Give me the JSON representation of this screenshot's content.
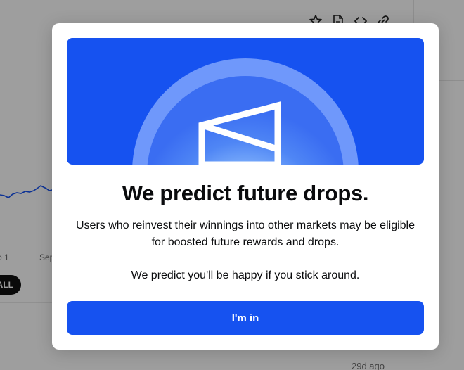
{
  "background": {
    "chart_axis_labels": [
      "o 1",
      "Sep"
    ],
    "range_pill": "ALL",
    "timestamp": "29d ago",
    "toolbar_icons": [
      "star-icon",
      "document-icon",
      "code-icon",
      "link-icon"
    ]
  },
  "modal": {
    "title": "We predict future drops.",
    "body_line_1": "Users who reinvest their winnings into other markets may be eligible for boosted future rewards and drops.",
    "body_line_2": "We predict you'll be happy if you stick around.",
    "cta_label": "I'm in"
  },
  "colors": {
    "brand_blue": "#1652f0",
    "overlay": "rgba(0,0,0,0.38)",
    "title_text": "#0a0b0d"
  }
}
